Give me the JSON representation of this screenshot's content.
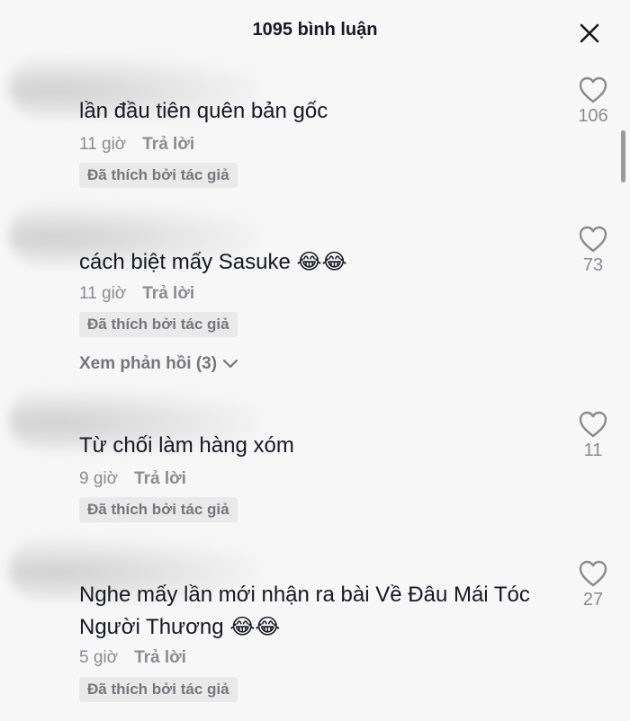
{
  "header": {
    "title": "1095 bình luận",
    "close_icon": "close-icon"
  },
  "comments": [
    {
      "text": "lần đầu tiên quên bản gốc",
      "emoji": "",
      "time": "11 giờ",
      "reply_label": "Trả lời",
      "badge": "Đã thích bởi tác giả",
      "likes": "106"
    },
    {
      "text": "cách biệt mấy Sasuke",
      "emoji": "😂😂",
      "time": "11 giờ",
      "reply_label": "Trả lời",
      "badge": "Đã thích bởi tác giả",
      "likes": "73",
      "view_replies": "Xem phản hồi (3)"
    },
    {
      "text": "Từ chối làm hàng xóm",
      "emoji": "",
      "time": "9 giờ",
      "reply_label": "Trả lời",
      "badge": "Đã thích bởi tác giả",
      "likes": "11"
    },
    {
      "text_line1": "Nghe mấy lần mới nhận ra bài Về Đâu Mái Tóc",
      "text_line2": "Người Thương",
      "emoji": "😂😂",
      "time": "5 giờ",
      "reply_label": "Trả lời",
      "badge": "Đã thích bởi tác giả",
      "likes": "27"
    }
  ],
  "colors": {
    "background": "#f7f7f7",
    "text": "#161823",
    "muted": "#8a8b91",
    "badge_bg": "#e9e9ea"
  }
}
